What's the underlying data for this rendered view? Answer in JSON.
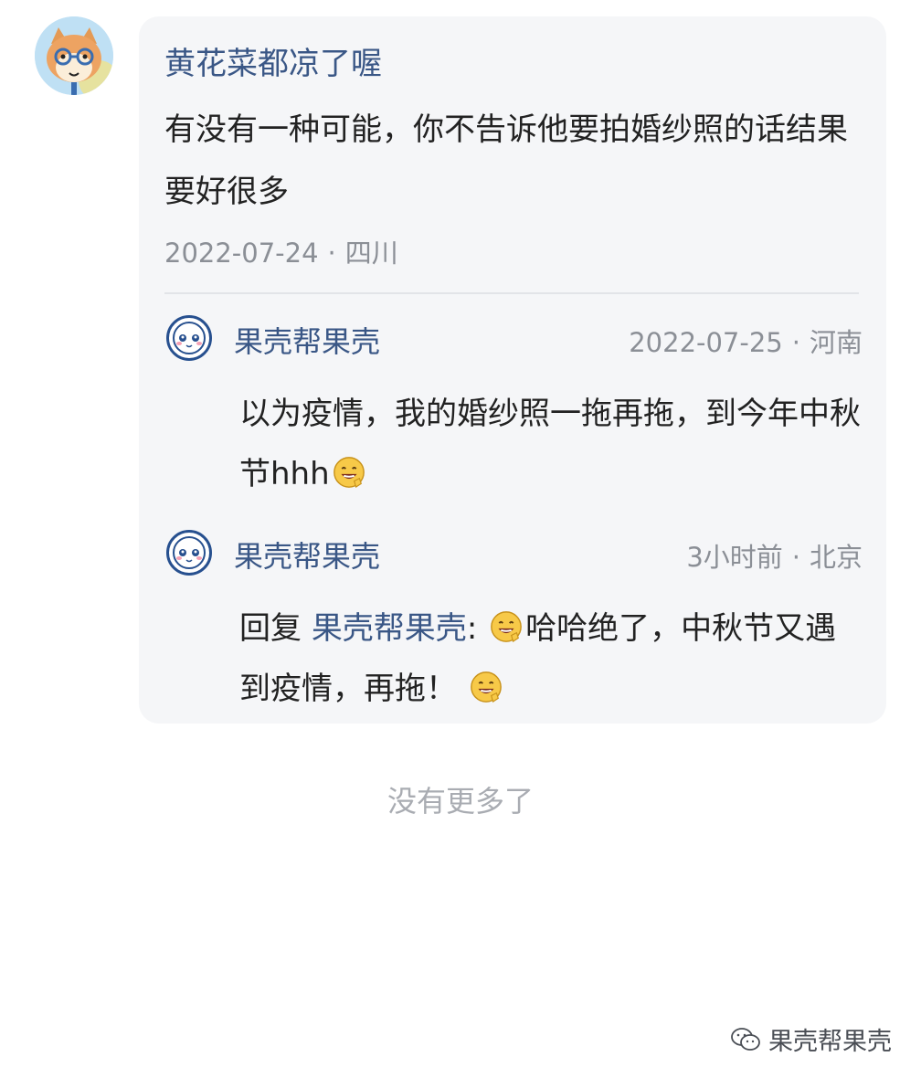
{
  "comment": {
    "author": "黄花菜都凉了喔",
    "text": "有没有一种可能，你不告诉他要拍婚纱照的话结果要好很多",
    "date": "2022-07-24",
    "location": "四川"
  },
  "replies": [
    {
      "author": "果壳帮果壳",
      "date": "2022-07-25",
      "location": "河南",
      "text": "以为疫情，我的婚纱照一拖再拖，到今年中秋节hhh",
      "emoji": "grin-emoji"
    },
    {
      "author": "果壳帮果壳",
      "date": "3小时前",
      "location": "北京",
      "reply_prefix": "回复",
      "mention": "果壳帮果壳",
      "text_part1": "哈哈绝了，中秋节又遇到疫情，再拖！",
      "emoji": "grin-emoji"
    }
  ],
  "footer": {
    "no_more": "没有更多了"
  },
  "watermark": {
    "label": "果壳帮果壳",
    "icon": "wechat-icon"
  },
  "colors": {
    "name_blue": "#3a5786",
    "meta_gray": "#8b8f96",
    "card_bg": "#f5f6f8"
  },
  "separator": "·"
}
